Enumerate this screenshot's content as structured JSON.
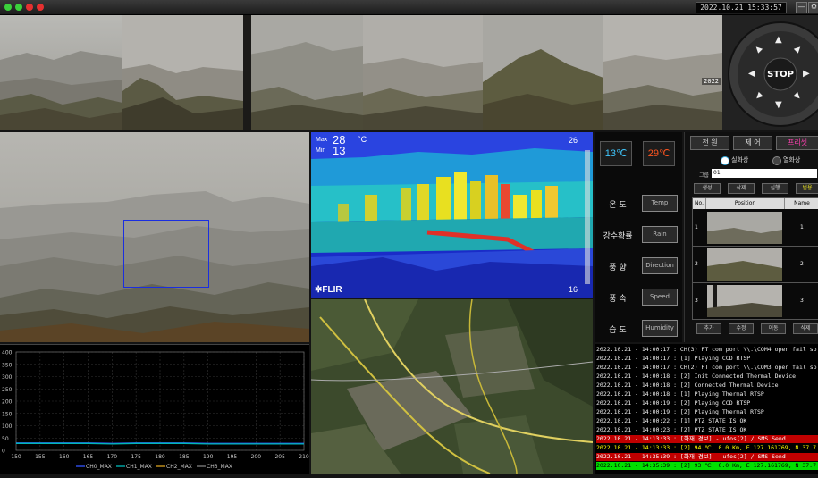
{
  "clock": "2022.10.21   15:33:57",
  "panorama": {
    "tags": [
      "",
      "",
      "",
      "",
      "",
      "",
      "2022"
    ]
  },
  "ptz": {
    "stop_label": "STOP"
  },
  "thermal": {
    "max_label": "Max",
    "max_value": "28",
    "unit": "°C",
    "min_label": "Min",
    "min_value": "13",
    "top_right": "26",
    "bottom_right": "16",
    "brand": "FLIR"
  },
  "sensors": {
    "temp1": "13℃",
    "temp2": "29℃",
    "rows": [
      {
        "label": "온 도",
        "button": "Temp"
      },
      {
        "label": "강수확률",
        "button": "Rain"
      },
      {
        "label": "풍 향",
        "button": "Direction"
      },
      {
        "label": "풍 속",
        "button": "Speed"
      },
      {
        "label": "습 도",
        "button": "Humidity"
      }
    ]
  },
  "preset": {
    "tabs": [
      "전 원",
      "제 어",
      "프리셋"
    ],
    "radio_on": "실화상",
    "radio_off": "열화상",
    "group_label": "그룹",
    "group_value": "01",
    "top_buttons": [
      "생성",
      "삭제",
      "실행",
      "범용"
    ],
    "columns": [
      "No.",
      "Position",
      "Name"
    ],
    "rows": [
      {
        "no": "1",
        "name": "1"
      },
      {
        "no": "2",
        "name": "2"
      },
      {
        "no": "3",
        "name": "3"
      }
    ],
    "bottom_buttons": [
      "추가",
      "수정",
      "이동",
      "삭제"
    ]
  },
  "chart_data": {
    "type": "line",
    "x": [
      150,
      155,
      160,
      165,
      170,
      175,
      180,
      185,
      190,
      195,
      200,
      205,
      210
    ],
    "xlim": [
      150,
      210
    ],
    "ylim": [
      0,
      400
    ],
    "yticks": [
      0,
      50,
      100,
      150,
      200,
      250,
      300,
      350,
      400
    ],
    "grid": true,
    "legend_position": "bottom",
    "series": [
      {
        "name": "CH0_MAX",
        "color": "#3355ff",
        "values": [
          30,
          30,
          30,
          30,
          28,
          30,
          30,
          30,
          28,
          28,
          28,
          28,
          28
        ]
      },
      {
        "name": "CH1_MAX",
        "color": "#00b8b8",
        "values": [
          28,
          28,
          28,
          28,
          26,
          28,
          28,
          28,
          26,
          26,
          26,
          26,
          26
        ]
      },
      {
        "name": "CH2_MAX",
        "color": "#d8a020",
        "values": [
          null,
          null,
          null,
          null,
          null,
          null,
          null,
          null,
          null,
          null,
          null,
          null,
          null
        ]
      },
      {
        "name": "CH3_MAX",
        "color": "#808080",
        "values": [
          null,
          null,
          null,
          null,
          null,
          null,
          null,
          null,
          null,
          null,
          null,
          null,
          null
        ]
      }
    ]
  },
  "log": [
    {
      "text": "2022.10.21 - 14:00:17 : CH(3) PT com port \\\\.\\COM4 open fail sp",
      "color": "#eeeeee",
      "bg": ""
    },
    {
      "text": "2022.10.21 - 14:00:17 : [1] Playing CCD RTSP",
      "color": "#eeeeee",
      "bg": ""
    },
    {
      "text": "2022.10.21 - 14:00:17 : CH(2) PT com port \\\\.\\COM3 open fail sp",
      "color": "#eeeeee",
      "bg": ""
    },
    {
      "text": "2022.10.21 - 14:00:18 : [2] Init Connected Thermal Device",
      "color": "#eeeeee",
      "bg": ""
    },
    {
      "text": "2022.10.21 - 14:00:18 : [2] Connected Thermal Device",
      "color": "#eeeeee",
      "bg": ""
    },
    {
      "text": "2022.10.21 - 14:00:18 : [1] Playing Thermal RTSP",
      "color": "#eeeeee",
      "bg": ""
    },
    {
      "text": "2022.10.21 - 14:00:19 : [2] Playing CCD RTSP",
      "color": "#eeeeee",
      "bg": ""
    },
    {
      "text": "2022.10.21 - 14:00:19 : [2] Playing Thermal RTSP",
      "color": "#eeeeee",
      "bg": ""
    },
    {
      "text": "2022.10.21 - 14:00:22 : [1] PTZ STATE IS OK",
      "color": "#eeeeee",
      "bg": ""
    },
    {
      "text": "2022.10.21 - 14:00:23 : [2] PTZ STATE IS OK",
      "color": "#eeeeee",
      "bg": ""
    },
    {
      "text": "2022.10.21 - 14:13:33 : [화재 경보] - ufos[2] / SMS Send",
      "color": "#ffffff",
      "bg": "#c00000"
    },
    {
      "text": "2022.10.21 - 14:13:33 : [2] 94 ℃, 0.0 Km, E 127.161769, N 37.7",
      "color": "#ffff00",
      "bg": ""
    },
    {
      "text": "2022.10.21 - 14:35:39 : [화재 경보] - ufos[2] / SMS Send",
      "color": "#ffffff",
      "bg": "#c00000"
    },
    {
      "text": "2022.10.21 - 14:35:39 : [2] 93 ℃, 0.0 Km, E 127.161769, N 37.7",
      "color": "#000000",
      "bg": "#00e000"
    }
  ]
}
